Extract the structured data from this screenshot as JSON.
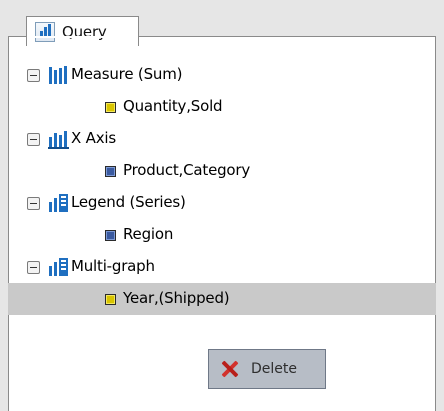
{
  "panel": {
    "title": "Query",
    "title_icon": "chart-icon"
  },
  "tree": {
    "groups": [
      {
        "label": "Measure (Sum)",
        "icon": "measure-bar-chart-icon",
        "item": {
          "label": "Quantity,Sold",
          "icon": "measure-field-icon"
        }
      },
      {
        "label": "X Axis",
        "icon": "x-axis-bar-chart-icon",
        "item": {
          "label": "Product,Category",
          "icon": "dimension-field-icon"
        }
      },
      {
        "label": "Legend (Series)",
        "icon": "legend-chart-icon",
        "item": {
          "label": "Region",
          "icon": "dimension-field-icon"
        }
      },
      {
        "label": "Multi-graph",
        "icon": "multi-graph-chart-icon",
        "item": {
          "label": "Year,(Shipped)",
          "icon": "measure-field-icon",
          "selected": true
        }
      }
    ]
  },
  "context_menu": {
    "items": [
      {
        "label": "Delete",
        "icon": "delete-x-icon"
      }
    ]
  },
  "colors": {
    "selection": "#c9c9c9",
    "chart_blue": "#1f6fc0",
    "measure_yellow": "#d8c400",
    "dimension_blue": "#3a5aa0",
    "delete_red": "#d2322d"
  }
}
